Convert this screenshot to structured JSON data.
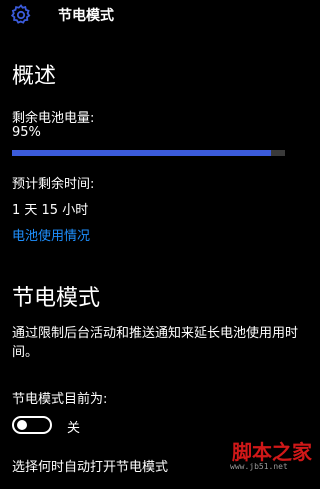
{
  "header": {
    "title": "节电模式",
    "icon": "gear-icon"
  },
  "overview": {
    "title": "概述",
    "battery_label": "剩余电池电量:",
    "battery_value": "95%",
    "battery_fraction": 0.95,
    "remaining_label": "预计剩余时间:",
    "remaining_value": "1 天 15 小时",
    "usage_link": "电池使用情况"
  },
  "saver": {
    "title": "节电模式",
    "description": "通过限制后台活动和推送通知来延长电池使用用时间。",
    "status_label": "节电模式目前为:",
    "toggle_state": "关",
    "bottom_text": "选择何时自动打开节电模式"
  },
  "watermark": {
    "text": "脚本之家",
    "url": "www.jb51.net"
  },
  "colors": {
    "accent": "#3b5bdb",
    "link": "#1e90ff",
    "background": "#000000"
  }
}
